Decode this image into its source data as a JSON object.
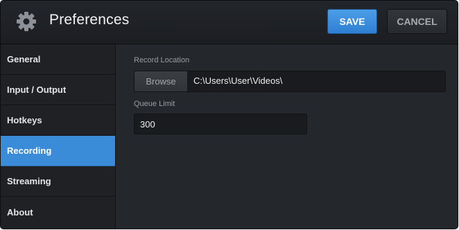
{
  "window": {
    "title": "Preferences",
    "icon": "gear-icon"
  },
  "toolbar": {
    "save_label": "SAVE",
    "cancel_label": "CANCEL"
  },
  "sidebar": {
    "items": [
      {
        "label": "General",
        "active": false
      },
      {
        "label": "Input / Output",
        "active": false
      },
      {
        "label": "Hotkeys",
        "active": false
      },
      {
        "label": "Recording",
        "active": true
      },
      {
        "label": "Streaming",
        "active": false
      },
      {
        "label": "About",
        "active": false
      }
    ]
  },
  "recording": {
    "record_location_label": "Record Location",
    "browse_label": "Browse",
    "record_location_value": "C:\\Users\\User\\Videos\\",
    "queue_limit_label": "Queue Limit",
    "queue_limit_value": "300"
  },
  "colors": {
    "accent": "#3a8bd8",
    "background": "#24272b",
    "sidebar": "#1f2125"
  }
}
